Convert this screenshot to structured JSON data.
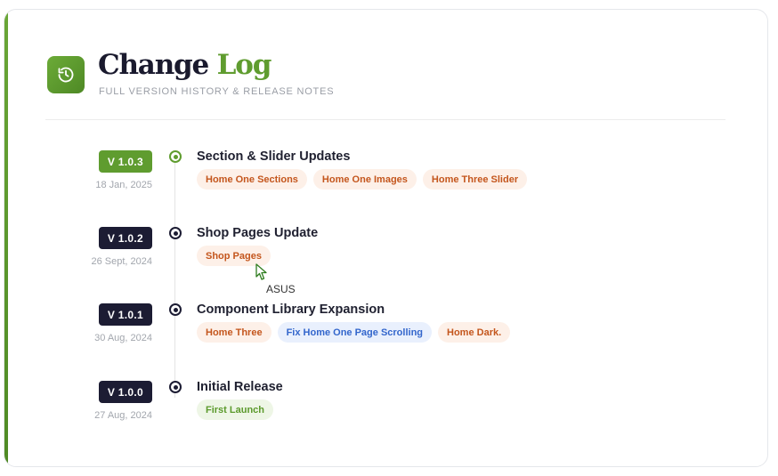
{
  "header": {
    "title_main": "Change",
    "title_accent": "Log",
    "subtitle": "Full Version History & Release Notes",
    "icon": "history-icon"
  },
  "colors": {
    "accent": "#5f9c2f",
    "dark": "#1c1c33",
    "tag_orange_text": "#c4561d",
    "tag_blue_text": "#3366cc",
    "tag_green_text": "#5b9a2c"
  },
  "releases": [
    {
      "version": "V 1.0.3",
      "date": "18 Jan, 2025",
      "title": "Section & Slider Updates",
      "tags": [
        "Home One Sections",
        "Home One Images",
        "Home Three Slider"
      ]
    },
    {
      "version": "V 1.0.2",
      "date": "26 Sept, 2024",
      "title": "Shop Pages Update",
      "tags": [
        "Shop Pages"
      ]
    },
    {
      "version": "V 1.0.1",
      "date": "30 Aug, 2024",
      "title": "Component Library Expansion",
      "tags": [
        "Home Three",
        "Fix Home One Page Scrolling",
        "Home Dark."
      ]
    },
    {
      "version": "V 1.0.0",
      "date": "27 Aug, 2024",
      "title": "Initial Release",
      "tags": [
        "First Launch"
      ]
    }
  ],
  "tooltip": "ASUS"
}
